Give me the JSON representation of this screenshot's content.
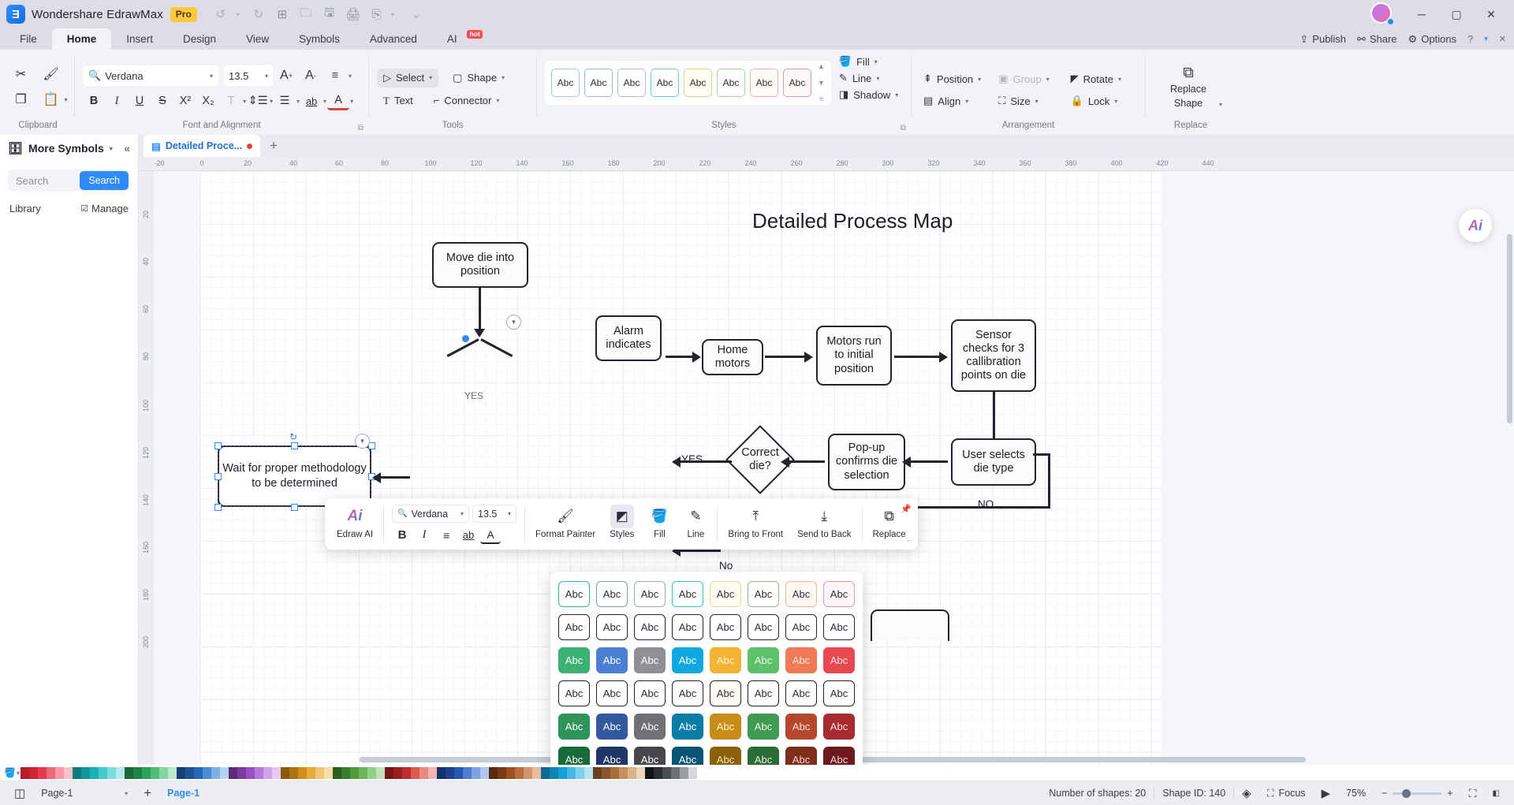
{
  "titlebar": {
    "app_name": "Wondershare EdrawMax",
    "badge": "Pro",
    "quick_actions": [
      "undo-icon",
      "redo-icon",
      "new-icon",
      "open-icon",
      "save-icon",
      "print-icon",
      "export-icon",
      "more-icon"
    ],
    "window_buttons": [
      "minimize",
      "maximize",
      "close"
    ]
  },
  "menubar": {
    "tabs": [
      {
        "label": "File",
        "active": false
      },
      {
        "label": "Home",
        "active": true
      },
      {
        "label": "Insert",
        "active": false
      },
      {
        "label": "Design",
        "active": false
      },
      {
        "label": "View",
        "active": false
      },
      {
        "label": "Symbols",
        "active": false
      },
      {
        "label": "Advanced",
        "active": false
      },
      {
        "label": "AI",
        "active": false,
        "badge": "hot"
      }
    ],
    "right_items": [
      {
        "label": "Publish",
        "icon": "publish-icon"
      },
      {
        "label": "Share",
        "icon": "share-icon"
      },
      {
        "label": "Options",
        "icon": "gear-icon"
      },
      {
        "label": "",
        "icon": "help-icon"
      },
      {
        "label": "",
        "icon": "chevron-down-icon"
      },
      {
        "label": "",
        "icon": "close-icon"
      }
    ]
  },
  "ribbon": {
    "groups": [
      {
        "name": "Clipboard",
        "label": "Clipboard"
      },
      {
        "name": "Font and Alignment",
        "label": "Font and Alignment"
      },
      {
        "name": "Tools",
        "label": "Tools"
      },
      {
        "name": "Styles",
        "label": "Styles"
      },
      {
        "name": "Arrangement",
        "label": "Arrangement"
      },
      {
        "name": "Replace",
        "label": "Replace"
      }
    ],
    "clipboard": {
      "cut": "cut-icon",
      "format_painter": "format-painter-icon",
      "copy": "copy-icon",
      "paste": "paste-icon"
    },
    "font": {
      "family_value": "Verdana",
      "size_value": "13.5",
      "grow_label": "A+",
      "shrink_label": "A-",
      "bold": "B",
      "italic": "I",
      "underline": "U",
      "strikethrough": "S",
      "superscript": "X²",
      "subscript": "X₂",
      "text_effect": "T",
      "line_spacing": "line-spacing-icon",
      "bullets": "bullets-icon",
      "highlight": "ab",
      "font_color": "A",
      "align": "align-icon"
    },
    "tools": {
      "select": "Select",
      "shape": "Shape",
      "text": "Text",
      "connector": "Connector"
    },
    "styles": {
      "swatch_label": "Abc",
      "swatch_count": 8,
      "swatch_colors": [
        "#cfe8e0",
        "#c7d6e8",
        "#cccdd6",
        "#9fd8ea",
        "#ecdfa8",
        "#cfe3c9",
        "#ecd3c6",
        "#e7c0c6"
      ]
    },
    "appearance": {
      "fill": "Fill",
      "line": "Line",
      "shadow": "Shadow"
    },
    "arrangement": {
      "position": "Position",
      "group": "Group",
      "rotate": "Rotate",
      "align": "Align",
      "size": "Size",
      "lock": "Lock"
    },
    "replace": {
      "label_line1": "Replace",
      "label_line2": "Shape"
    }
  },
  "sidebar": {
    "title": "More Symbols",
    "search_placeholder": "Search",
    "search_button": "Search",
    "library_label": "Library",
    "manage_label": "Manage"
  },
  "document": {
    "tab_name": "Detailed Proce...",
    "add_tab": "+"
  },
  "rulers": {
    "horizontal": [
      "-20",
      "0",
      "20",
      "40",
      "60",
      "80",
      "100",
      "120",
      "140",
      "160",
      "180",
      "200",
      "220",
      "240",
      "260",
      "280",
      "300",
      "320",
      "340",
      "360",
      "380",
      "400",
      "420",
      "440"
    ],
    "vertical": [
      "20",
      "40",
      "60",
      "80",
      "100",
      "120",
      "140",
      "160",
      "180",
      "200"
    ]
  },
  "diagram": {
    "title": "Detailed Process Map",
    "nodes": [
      {
        "id": "move-die",
        "text": "Move die into position"
      },
      {
        "id": "alarm",
        "text": "Alarm indicates"
      },
      {
        "id": "home-motors",
        "text": "Home motors"
      },
      {
        "id": "motors-run",
        "text": "Motors run to initial position"
      },
      {
        "id": "sensor-checks",
        "text": "Sensor checks for 3 callibration points on die"
      },
      {
        "id": "correct-die",
        "text": "Correct die?"
      },
      {
        "id": "popup-confirms",
        "text": "Pop-up confirms die selection"
      },
      {
        "id": "user-selects",
        "text": "User selects die type"
      },
      {
        "id": "wait-methodology",
        "text": "Wait for proper methodology to be determined"
      }
    ],
    "edge_labels": [
      {
        "id": "yes-label",
        "text": "YES"
      },
      {
        "id": "no-label",
        "text": "NO"
      },
      {
        "id": "no-label-2",
        "text": "No"
      },
      {
        "id": "yes-label-2",
        "text": "YES"
      }
    ]
  },
  "floating_toolbar": {
    "items": [
      {
        "name": "edraw-ai",
        "label": "Edraw AI",
        "icon": "ai-sparkle-icon"
      },
      {
        "name": "format-painter",
        "label": "Format Painter",
        "icon": "format-painter-icon"
      },
      {
        "name": "styles",
        "label": "Styles",
        "icon": "styles-icon"
      },
      {
        "name": "fill",
        "label": "Fill",
        "icon": "fill-icon"
      },
      {
        "name": "line",
        "label": "Line",
        "icon": "line-icon"
      },
      {
        "name": "bring-to-front",
        "label": "Bring to Front",
        "icon": "bring-to-front-icon"
      },
      {
        "name": "send-to-back",
        "label": "Send to Back",
        "icon": "send-to-back-icon"
      },
      {
        "name": "replace",
        "label": "Replace",
        "icon": "replace-icon"
      }
    ],
    "font_family": "Verdana",
    "font_size": "13.5",
    "format_buttons": [
      "B",
      "I",
      "align-icon",
      "ab",
      "A"
    ]
  },
  "style_palette": {
    "swatch_label": "Abc",
    "rows": [
      [
        {
          "bg": "#ffffff",
          "border": "#3fae89",
          "fg": "#2b2c36"
        },
        {
          "bg": "#ffffff",
          "border": "#7e9cc4",
          "fg": "#2b2c36"
        },
        {
          "bg": "#ffffff",
          "border": "#a8aab4",
          "fg": "#2b2c36"
        },
        {
          "bg": "#ffffff",
          "border": "#35c0e8",
          "fg": "#2b2c36"
        },
        {
          "bg": "#fffdf3",
          "border": "#ecd98a",
          "fg": "#2b2c36"
        },
        {
          "bg": "#ffffff",
          "border": "#86c98a",
          "fg": "#2b2c36"
        },
        {
          "bg": "#fff8f4",
          "border": "#eeb49a",
          "fg": "#2b2c36"
        },
        {
          "bg": "#fff6f7",
          "border": "#e29aa4",
          "fg": "#2b2c36"
        }
      ],
      [
        {
          "bg": "#ffffff",
          "border": "#22232c",
          "fg": "#2b2c36"
        },
        {
          "bg": "#ffffff",
          "border": "#22232c",
          "fg": "#2b2c36"
        },
        {
          "bg": "#ffffff",
          "border": "#22232c",
          "fg": "#2b2c36"
        },
        {
          "bg": "#ffffff",
          "border": "#22232c",
          "fg": "#2b2c36"
        },
        {
          "bg": "#ffffff",
          "border": "#22232c",
          "fg": "#2b2c36"
        },
        {
          "bg": "#ffffff",
          "border": "#22232c",
          "fg": "#2b2c36"
        },
        {
          "bg": "#ffffff",
          "border": "#22232c",
          "fg": "#2b2c36"
        },
        {
          "bg": "#ffffff",
          "border": "#22232c",
          "fg": "#2b2c36"
        }
      ],
      [
        {
          "bg": "#3bb273",
          "border": "#3bb273",
          "fg": "#ffffff"
        },
        {
          "bg": "#4a7fd4",
          "border": "#4a7fd4",
          "fg": "#ffffff"
        },
        {
          "bg": "#8e9094",
          "border": "#8e9094",
          "fg": "#ffffff"
        },
        {
          "bg": "#0fa8e0",
          "border": "#0fa8e0",
          "fg": "#ffffff"
        },
        {
          "bg": "#f4b433",
          "border": "#f4b433",
          "fg": "#fff6d8"
        },
        {
          "bg": "#5cc16a",
          "border": "#5cc16a",
          "fg": "#eefbe9"
        },
        {
          "bg": "#f07a55",
          "border": "#f07a55",
          "fg": "#ffe9e0"
        },
        {
          "bg": "#e8484f",
          "border": "#e8484f",
          "fg": "#ffe6e6"
        }
      ],
      [
        {
          "bg": "#ffffff",
          "border": "#22232c",
          "fg": "#2b2c36"
        },
        {
          "bg": "#ffffff",
          "border": "#22232c",
          "fg": "#2b2c36"
        },
        {
          "bg": "#ffffff",
          "border": "#22232c",
          "fg": "#2b2c36"
        },
        {
          "bg": "#ffffff",
          "border": "#22232c",
          "fg": "#2b2c36"
        },
        {
          "bg": "#fffdf5",
          "border": "#22232c",
          "fg": "#2b2c36"
        },
        {
          "bg": "#ffffff",
          "border": "#22232c",
          "fg": "#2b2c36"
        },
        {
          "bg": "#ffffff",
          "border": "#22232c",
          "fg": "#2b2c36"
        },
        {
          "bg": "#ffffff",
          "border": "#22232c",
          "fg": "#2b2c36"
        }
      ],
      [
        {
          "bg": "#2e9459",
          "border": "#2e9459",
          "fg": "#ffffff"
        },
        {
          "bg": "#32589e",
          "border": "#32589e",
          "fg": "#ffffff"
        },
        {
          "bg": "#6f7175",
          "border": "#6f7175",
          "fg": "#ffffff"
        },
        {
          "bg": "#0b7ea8",
          "border": "#0b7ea8",
          "fg": "#ffffff"
        },
        {
          "bg": "#c88d16",
          "border": "#c88d16",
          "fg": "#fff3d0"
        },
        {
          "bg": "#3f9a52",
          "border": "#3f9a52",
          "fg": "#e9f7e4"
        },
        {
          "bg": "#b5482c",
          "border": "#b5482c",
          "fg": "#ffe2d8"
        },
        {
          "bg": "#a72b2f",
          "border": "#a72b2f",
          "fg": "#ffdede"
        }
      ],
      [
        {
          "bg": "#186c3a",
          "border": "#186c3a",
          "fg": "#ffffff"
        },
        {
          "bg": "#1e3668",
          "border": "#1e3668",
          "fg": "#ffffff"
        },
        {
          "bg": "#46474b",
          "border": "#46474b",
          "fg": "#ffffff"
        },
        {
          "bg": "#0a5575",
          "border": "#0a5575",
          "fg": "#ffffff"
        },
        {
          "bg": "#8a6009",
          "border": "#8a6009",
          "fg": "#f6e4b8"
        },
        {
          "bg": "#2a6b36",
          "border": "#2a6b36",
          "fg": "#e0f0da"
        },
        {
          "bg": "#7d2f1b",
          "border": "#7d2f1b",
          "fg": "#f5d6c9"
        },
        {
          "bg": "#6d1a1e",
          "border": "#6d1a1e",
          "fg": "#f3cfcf"
        }
      ]
    ]
  },
  "colorbar": {
    "fill_icon": "fill-bucket-icon",
    "colors": [
      "#b81c2a",
      "#d02333",
      "#e33a4e",
      "#ee6a78",
      "#f79aa6",
      "#fbc2ca",
      "#0f7b7f",
      "#12989c",
      "#18b2b6",
      "#47c8cb",
      "#7edcde",
      "#b2ecec",
      "#1a6a3a",
      "#1f8247",
      "#2aa25a",
      "#4dbd79",
      "#83d6a0",
      "#b8e9c9",
      "#163f7a",
      "#1d5296",
      "#2668b8",
      "#4a8cd6",
      "#7fb0e5",
      "#b4d2f1",
      "#5c2b7a",
      "#7a3aa0",
      "#9a4ec4",
      "#b678db",
      "#cfa2ea",
      "#e5c9f4",
      "#8a5a0c",
      "#ad7310",
      "#d08f18",
      "#e6ab3d",
      "#f0c573",
      "#f8deab",
      "#2a5f20",
      "#3a7c2c",
      "#4c9c3a",
      "#6ab757",
      "#93cf85",
      "#c0e3b7",
      "#7a1515",
      "#9c1f1f",
      "#bf2c2c",
      "#d95a52",
      "#e98a82",
      "#f3b5ae",
      "#14306e",
      "#1c4390",
      "#2558b5",
      "#4b7dd0",
      "#7ea3e2",
      "#b0c6ef",
      "#5c2a12",
      "#7a3a18",
      "#9c4f21",
      "#bb6c3c",
      "#d2946b",
      "#e6bb9e",
      "#0a6a93",
      "#0d85b5",
      "#12a0d6",
      "#45b8e4",
      "#7fd0ed",
      "#b6e4f5",
      "#6b4020",
      "#8a5529",
      "#a96e38",
      "#c4905e",
      "#dab38b",
      "#eed4b8",
      "#111318",
      "#2b2d34",
      "#4a4c55",
      "#6d6f79",
      "#9b9da6",
      "#d6d7dd",
      "#ffffff"
    ]
  },
  "statusbar": {
    "page_selector": "Page-1",
    "add_page": "+",
    "page_tab": "Page-1",
    "shapes_count": "Number of shapes: 20",
    "shape_id": "Shape ID: 140",
    "layers_icon": "layers-icon",
    "focus_label": "Focus",
    "present_icon": "present-icon",
    "zoom_level": "75%",
    "zoom_out": "−",
    "zoom_in": "+",
    "fit_icon": "fit-screen-icon",
    "expand_icon": "expand-icon"
  }
}
